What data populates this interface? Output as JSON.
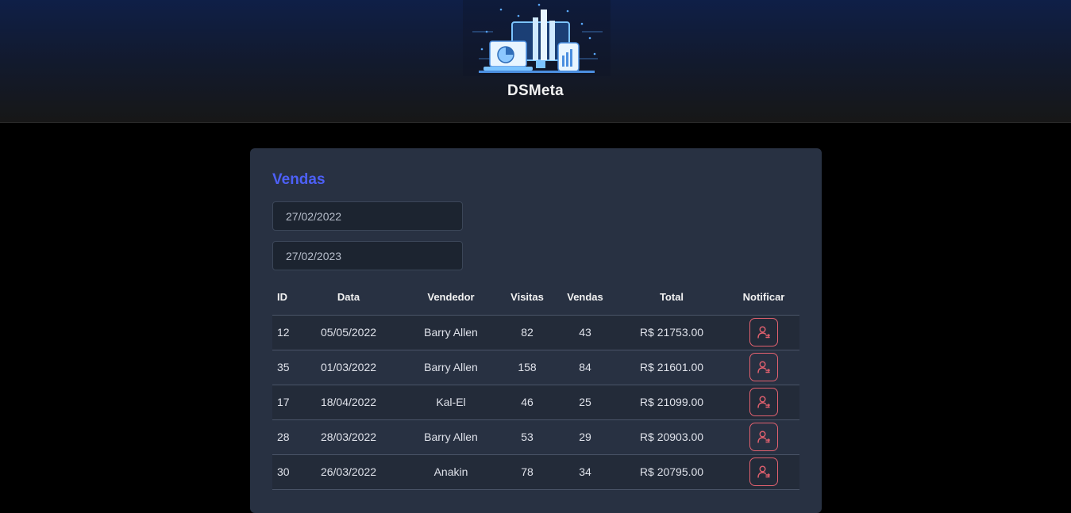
{
  "header": {
    "title": "DSMeta"
  },
  "card": {
    "title": "Vendas",
    "min_date": "27/02/2022",
    "max_date": "27/02/2023"
  },
  "table": {
    "headers": [
      "ID",
      "Data",
      "Vendedor",
      "Visitas",
      "Vendas",
      "Total",
      "Notificar"
    ],
    "rows": [
      {
        "id": "12",
        "date": "05/05/2022",
        "seller": "Barry Allen",
        "visits": "82",
        "deals": "43",
        "total": "R$ 21753.00"
      },
      {
        "id": "35",
        "date": "01/03/2022",
        "seller": "Barry Allen",
        "visits": "158",
        "deals": "84",
        "total": "R$ 21601.00"
      },
      {
        "id": "17",
        "date": "18/04/2022",
        "seller": "Kal-El",
        "visits": "46",
        "deals": "25",
        "total": "R$ 21099.00"
      },
      {
        "id": "28",
        "date": "28/03/2022",
        "seller": "Barry Allen",
        "visits": "53",
        "deals": "29",
        "total": "R$ 20903.00"
      },
      {
        "id": "30",
        "date": "26/03/2022",
        "seller": "Anakin",
        "visits": "78",
        "deals": "34",
        "total": "R$ 20795.00"
      }
    ]
  },
  "icons": {
    "notify": "user-notify-icon",
    "logo": "dashboard-devices-logo"
  },
  "colors": {
    "accent": "#4d60f7",
    "notify": "#e2616f",
    "card": "#283142"
  }
}
